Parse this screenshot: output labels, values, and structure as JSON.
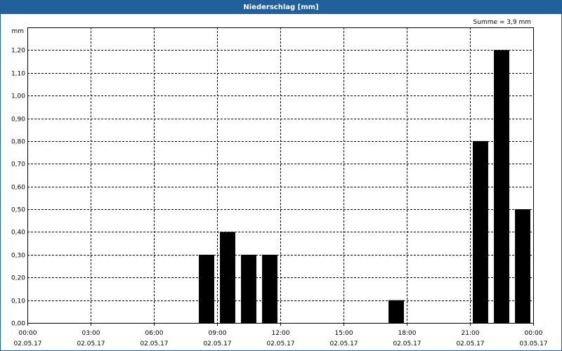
{
  "window": {
    "title": "Niederschlag [mm]"
  },
  "chart_data": {
    "type": "bar",
    "title": "Niederschlag [mm]",
    "ylabel": "mm",
    "annotation": "Summe = 3,9 mm",
    "ylim": [
      0,
      1.3
    ],
    "grid": true,
    "y_ticks": [
      "0,00",
      "0,10",
      "0,20",
      "0,30",
      "0,40",
      "0,50",
      "0,60",
      "0,70",
      "0,80",
      "0,90",
      "1,00",
      "1,10",
      "1,20"
    ],
    "x_ticks": [
      {
        "time": "00:00",
        "date": "02.05.17"
      },
      {
        "time": "03:00",
        "date": "02.05.17"
      },
      {
        "time": "06:00",
        "date": "02.05.17"
      },
      {
        "time": "09:00",
        "date": "02.05.17"
      },
      {
        "time": "12:00",
        "date": "02.05.17"
      },
      {
        "time": "15:00",
        "date": "02.05.17"
      },
      {
        "time": "18:00",
        "date": "02.05.17"
      },
      {
        "time": "21:00",
        "date": "02.05.17"
      },
      {
        "time": "00:00",
        "date": "03.05.17"
      }
    ],
    "x_range_hours": [
      0,
      24
    ],
    "bars": [
      {
        "hour": 9,
        "value": 0.3
      },
      {
        "hour": 10,
        "value": 0.4
      },
      {
        "hour": 11,
        "value": 0.3
      },
      {
        "hour": 12,
        "value": 0.3
      },
      {
        "hour": 18,
        "value": 0.1
      },
      {
        "hour": 22,
        "value": 0.8
      },
      {
        "hour": 23,
        "value": 1.2
      },
      {
        "hour": 24,
        "value": 0.5
      }
    ],
    "colors": {
      "bar": "#000000",
      "grid": "#000000",
      "titlebar": "#22609b"
    }
  }
}
